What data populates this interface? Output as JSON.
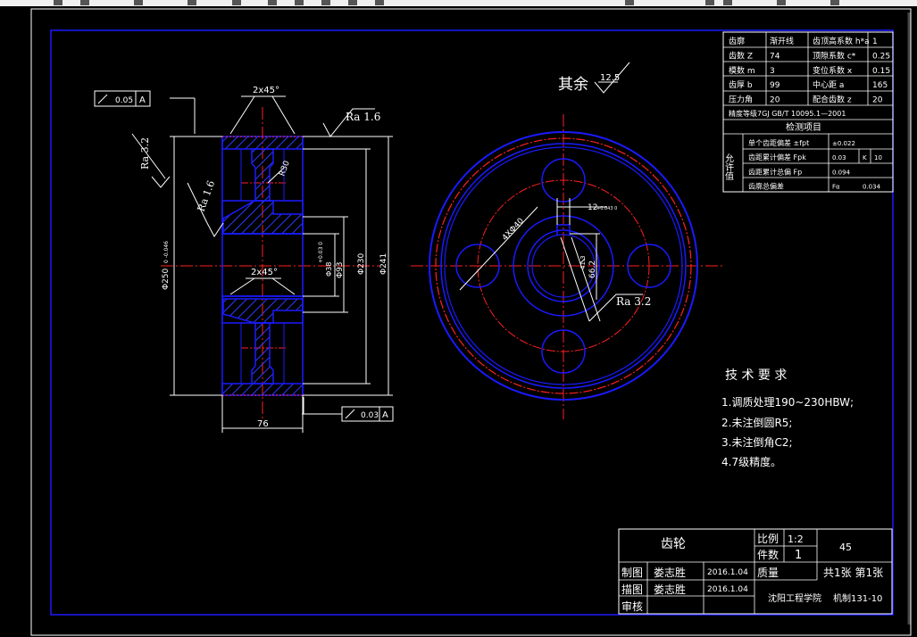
{
  "top_note": {
    "surface_all": "其余",
    "ra_all": "12.5"
  },
  "dims": {
    "chamfer_top": "2x45°",
    "chamfer_mid": "2x45°",
    "ra_16_right": "Ra 1.6",
    "ra_32_left": "Ra 3.2",
    "ra_16_inner": "Ra 1.6",
    "r30": "R30",
    "d250": "Φ250",
    "d250_tol": "0 -0.046",
    "d38": "Φ38",
    "d38_tol": "+0.03 0",
    "d93": "Φ93",
    "d230": "Φ230",
    "d241": "Φ241",
    "width_76": "76",
    "d_holes": "4XΦ40",
    "key_width": "12",
    "key_tol": "+0.043 0",
    "key_depth": "66.2",
    "key_depth2": "41.3",
    "ra_32_bore": "Ra 3.2",
    "tol_top_value": "0.05",
    "tol_top_ref": "A",
    "tol_bot_value": "0.03",
    "tol_bot_ref": "A"
  },
  "param_table": {
    "rows": [
      [
        "齿廓",
        "渐开线",
        "齿顶高系数 h*a",
        "1"
      ],
      [
        "齿数 Z",
        "74",
        "顶隙系数 c*",
        "0.25"
      ],
      [
        "模数 m",
        "3",
        "变位系数 x",
        "0.15"
      ],
      [
        "齿厚 b",
        "99",
        "中心距 a",
        "165"
      ],
      [
        "压力角",
        "20",
        "配合齿数 z",
        "20"
      ]
    ],
    "precision": "精度等级7GJ GB/T 10095.1—2001",
    "check_items": "检测项目",
    "allow_label": "允许值",
    "check_rows": [
      [
        "单个齿距偏差 ±fpt",
        "±0.022",
        "",
        ""
      ],
      [
        "齿距累计偏差 Fpk",
        "0.03",
        "K",
        "10"
      ],
      [
        "齿距累计总偏 Fp",
        "0.094",
        "",
        ""
      ],
      [
        "齿廓总偏差",
        "Fα",
        "0.034",
        ""
      ]
    ]
  },
  "tech_req": {
    "title": "技 术 要 求",
    "items": [
      "1.调质处理190~230HBW;",
      "2.未注倒圆R5;",
      "3.未注倒角C2;",
      "4.7级精度。"
    ]
  },
  "title_block": {
    "part_name": "齿轮",
    "scale_label": "比例",
    "scale": "1:2",
    "qty_label": "件数",
    "qty": "1",
    "material": "45",
    "mass_label": "质量",
    "sheets": "共1张 第1张",
    "drawn_label": "制图",
    "drawn_by": "娄志胜",
    "drawn_date": "2016.1.04",
    "traced_label": "描图",
    "traced_by": "娄志胜",
    "traced_date": "2016.1.04",
    "review_label": "审核",
    "school": "沈阳工程学院",
    "class": "机制131-10"
  },
  "colors": {
    "outline": "#0000ff",
    "center": "#ff0000",
    "dim": "#ffffff",
    "hatch": "#0000ff"
  }
}
